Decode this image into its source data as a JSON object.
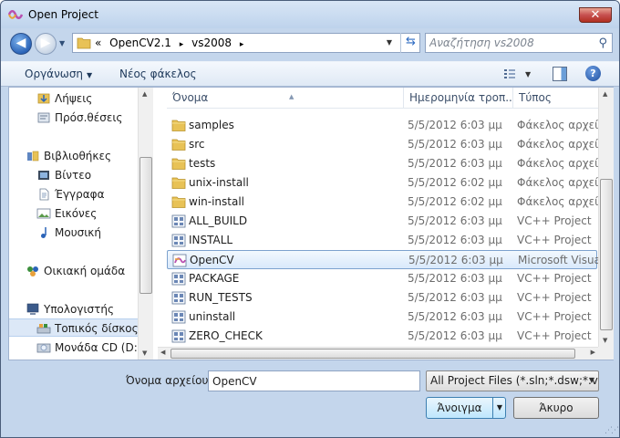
{
  "window": {
    "title": "Open Project",
    "close_label": "✕"
  },
  "nav": {
    "breadcrumb": [
      "«",
      "OpenCV2.1",
      "▸",
      "vs2008",
      "▸"
    ],
    "search_placeholder": "Αναζήτηση vs2008"
  },
  "toolbar": {
    "organize_label": "Οργάνωση",
    "new_folder_label": "Νέος φάκελος"
  },
  "sidebar": {
    "items": [
      {
        "label": "Λήψεις",
        "icon": "downloads-icon"
      },
      {
        "label": "Πρόσ.θέσεις",
        "icon": "recent-places-icon"
      },
      {
        "label": "Βιβλιοθήκες",
        "icon": "libraries-icon"
      },
      {
        "label": "Βίντεο",
        "icon": "videos-icon"
      },
      {
        "label": "Έγγραφα",
        "icon": "documents-icon"
      },
      {
        "label": "Εικόνες",
        "icon": "pictures-icon"
      },
      {
        "label": "Μουσική",
        "icon": "music-icon"
      },
      {
        "label": "Οικιακή ομάδα",
        "icon": "homegroup-icon"
      },
      {
        "label": "Υπολογιστής",
        "icon": "computer-icon"
      },
      {
        "label": "Τοπικός δίσκος (",
        "icon": "local-disk-icon"
      },
      {
        "label": "Μονάδα CD (D:)",
        "icon": "cd-drive-icon"
      }
    ]
  },
  "files": {
    "columns": [
      "Όνομα",
      "Ημερομηνία τροπ...",
      "Τύπος"
    ],
    "rows": [
      {
        "name": "samples",
        "date": "5/5/2012 6:03 μμ",
        "type": "Φάκελος αρχείων",
        "kind": "folder"
      },
      {
        "name": "src",
        "date": "5/5/2012 6:03 μμ",
        "type": "Φάκελος αρχείων",
        "kind": "folder"
      },
      {
        "name": "tests",
        "date": "5/5/2012 6:03 μμ",
        "type": "Φάκελος αρχείων",
        "kind": "folder"
      },
      {
        "name": "unix-install",
        "date": "5/5/2012 6:02 μμ",
        "type": "Φάκελος αρχείων",
        "kind": "folder"
      },
      {
        "name": "win-install",
        "date": "5/5/2012 6:02 μμ",
        "type": "Φάκελος αρχείων",
        "kind": "folder"
      },
      {
        "name": "ALL_BUILD",
        "date": "5/5/2012 6:03 μμ",
        "type": "VC++ Project",
        "kind": "project"
      },
      {
        "name": "INSTALL",
        "date": "5/5/2012 6:03 μμ",
        "type": "VC++ Project",
        "kind": "project"
      },
      {
        "name": "OpenCV",
        "date": "5/5/2012 6:03 μμ",
        "type": "Microsoft Visual",
        "kind": "solution"
      },
      {
        "name": "PACKAGE",
        "date": "5/5/2012 6:03 μμ",
        "type": "VC++ Project",
        "kind": "project"
      },
      {
        "name": "RUN_TESTS",
        "date": "5/5/2012 6:03 μμ",
        "type": "VC++ Project",
        "kind": "project"
      },
      {
        "name": "uninstall",
        "date": "5/5/2012 6:03 μμ",
        "type": "VC++ Project",
        "kind": "project"
      },
      {
        "name": "ZERO_CHECK",
        "date": "5/5/2012 6:03 μμ",
        "type": "VC++ Project",
        "kind": "project"
      }
    ],
    "selected_index": 7
  },
  "footer": {
    "filename_label": "Όνομα αρχείου:",
    "filename_value": "OpenCV",
    "filter_value": "All Project Files (*.sln;*.dsw;*.vc",
    "open_label": "Άνοιγμα",
    "cancel_label": "Άκυρο"
  },
  "colors": {
    "frame": "#c4d6ec",
    "selection": "#d9e9fb",
    "folder": "#e8c256",
    "accent": "#2b64b8"
  }
}
